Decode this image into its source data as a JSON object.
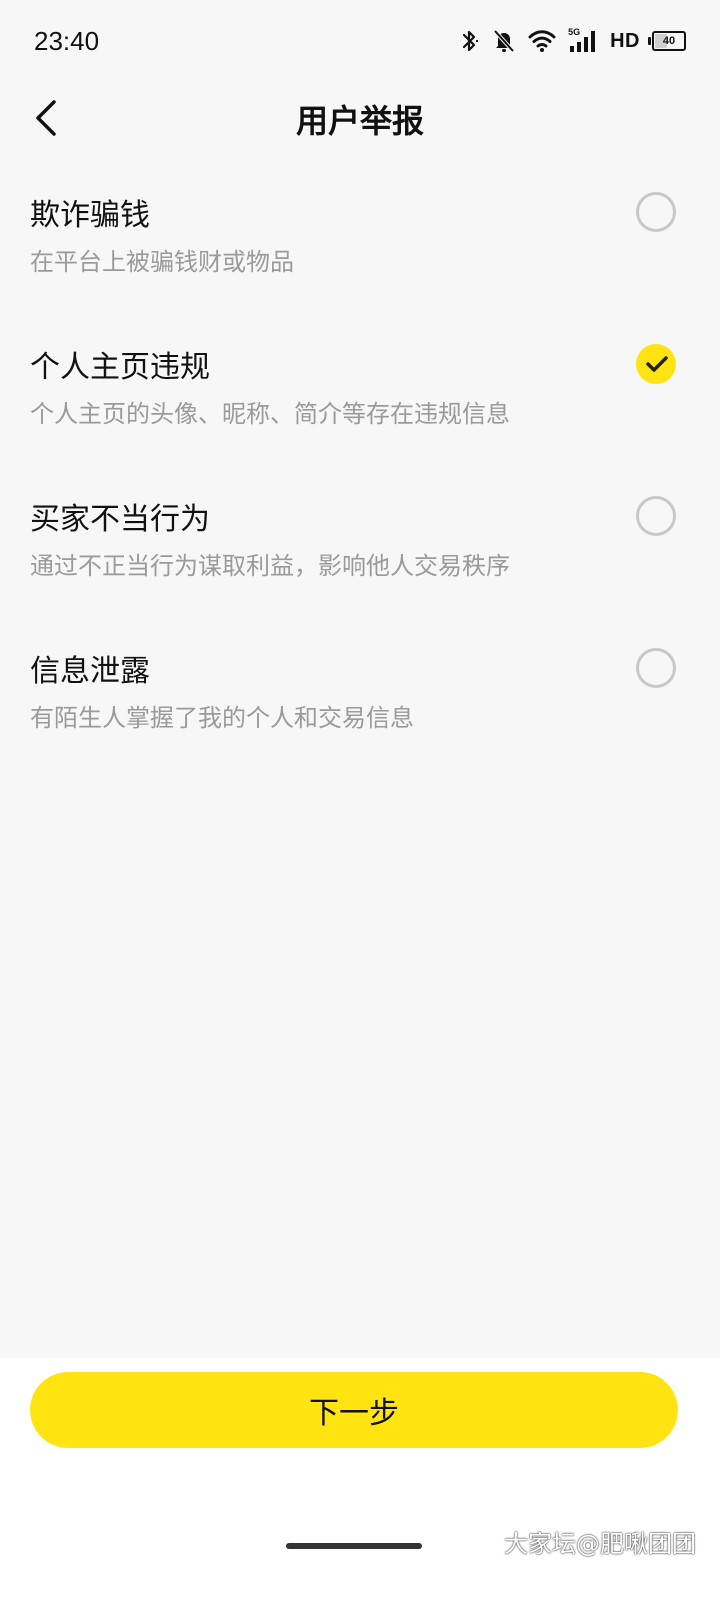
{
  "status_bar": {
    "time": "23:40",
    "network_label": "5G",
    "hd_label": "HD",
    "battery_level": "40",
    "icons": [
      "bluetooth-icon",
      "mute-icon",
      "wifi-icon",
      "signal-icon",
      "battery-icon"
    ]
  },
  "header": {
    "title": "用户举报",
    "back_icon": "chevron-left-icon"
  },
  "options": [
    {
      "title": "欺诈骗钱",
      "description": "在平台上被骗钱财或物品",
      "selected": false
    },
    {
      "title": "个人主页违规",
      "description": "个人主页的头像、昵称、简介等存在违规信息",
      "selected": true
    },
    {
      "title": "买家不当行为",
      "description": "通过不正当行为谋取利益，影响他人交易秩序",
      "selected": false
    },
    {
      "title": "信息泄露",
      "description": "有陌生人掌握了我的个人和交易信息",
      "selected": false
    }
  ],
  "footer": {
    "next_button_label": "下一步"
  },
  "watermark": "大家坛@肥啾团团",
  "colors": {
    "accent": "#ffe411",
    "background": "#f7f7f7",
    "text_primary": "#111111",
    "text_secondary": "#9a9a9a",
    "radio_border": "#c8c8c8"
  }
}
